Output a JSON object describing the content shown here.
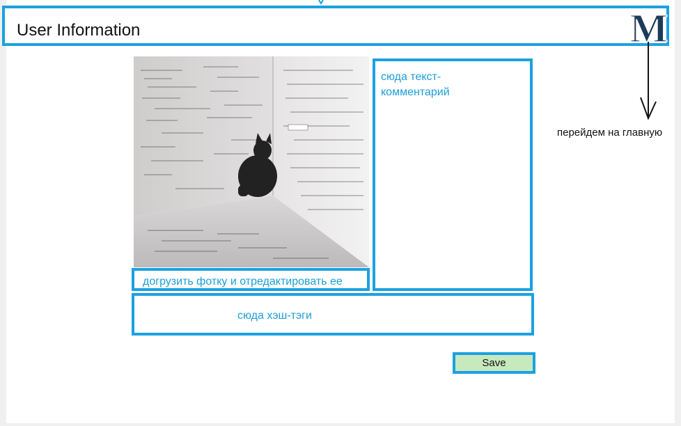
{
  "header": {
    "title": "User Information",
    "logo": "M"
  },
  "photo": {
    "description_icon": "cat-photo-icon"
  },
  "upload": {
    "label": "догрузить фотку и отредактировать ее"
  },
  "comment": {
    "label": "сюда текст-комментарий"
  },
  "tags": {
    "label": "сюда хэш-тэги"
  },
  "save": {
    "label": "Save"
  },
  "annotation": {
    "note": "перейдем на главную"
  },
  "colors": {
    "accent": "#1ba1e2",
    "text_blue": "#1a9ed8",
    "save_bg": "#c7e9bd"
  }
}
